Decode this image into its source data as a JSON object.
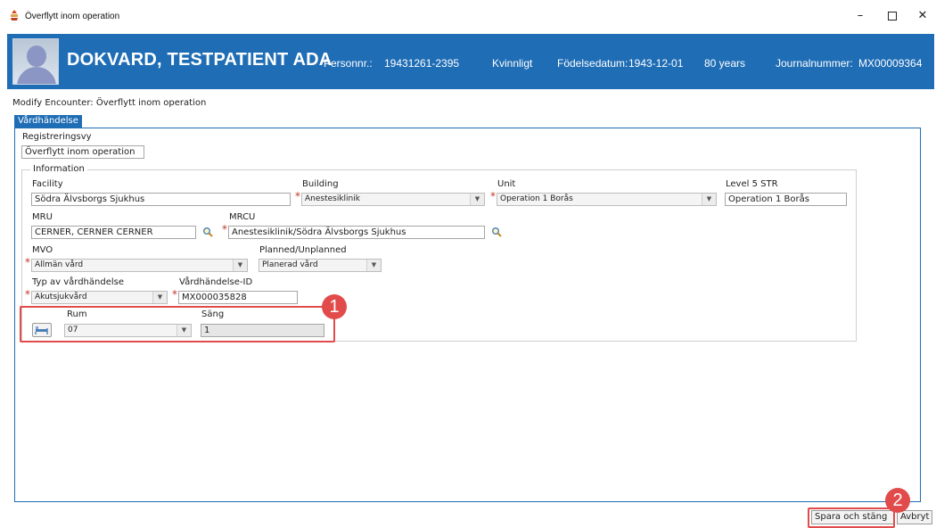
{
  "window": {
    "title": "Överflytt inom operation",
    "minimize": "–",
    "close": "✕"
  },
  "banner": {
    "patient_name": "DOKVARD, TESTPATIENT ADA",
    "personnr_label": "Personnr.:",
    "personnr": "19431261-2395",
    "gender": "Kvinnligt",
    "dob_label": "Födelsedatum:",
    "dob": "1943-12-01",
    "age": "80 years",
    "journal_label": "Journalnummer:",
    "journal": "MX00009364",
    "colors": {
      "banner_bg": "#1f6db5",
      "text": "#ffffff"
    }
  },
  "subtitle": "Modify Encounter: Överflytt inom operation",
  "tab": "Vårdhändelse",
  "registreringsvy": {
    "label": "Registreringsvy",
    "value": "Överflytt inom operation"
  },
  "information": {
    "legend": "Information",
    "facility": {
      "label": "Facility",
      "value": "Södra Älvsborgs Sjukhus"
    },
    "building": {
      "label": "Building",
      "value": "Anestesiklinik"
    },
    "unit": {
      "label": "Unit",
      "value": "Operation 1 Borås"
    },
    "level5": {
      "label": "Level 5 STR",
      "value": "Operation 1 Borås"
    },
    "mru": {
      "label": "MRU",
      "value": "CERNER, CERNER CERNER"
    },
    "mrcu": {
      "label": "MRCU",
      "value": "Anestesiklinik/Södra Älvsborgs Sjukhus"
    },
    "mvo": {
      "label": "MVO",
      "value": "Allmän vård"
    },
    "planned": {
      "label": "Planned/Unplanned",
      "value": "Planerad vård"
    },
    "typ": {
      "label": "Typ av vårdhändelse",
      "value": "Akutsjukvård"
    },
    "vardhandelse_id": {
      "label": "Vårdhändelse-ID",
      "value": "MX000035828"
    },
    "rum": {
      "label": "Rum",
      "value": "07"
    },
    "sang": {
      "label": "Säng",
      "value": "1"
    }
  },
  "annotations": {
    "badge1": "1",
    "badge2": "2",
    "color": "#e24b4b"
  },
  "footer": {
    "save_close": "Spara och stäng",
    "cancel": "Avbryt"
  },
  "icons": [
    "app-icon",
    "user-avatar",
    "search-icon",
    "bed-icon",
    "dropdown-arrow"
  ]
}
